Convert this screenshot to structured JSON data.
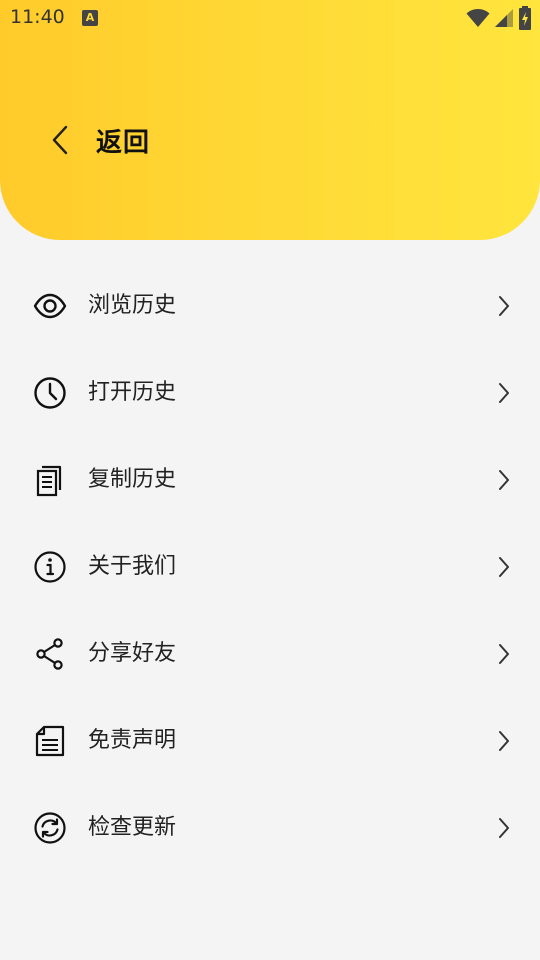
{
  "status_bar": {
    "time": "11:40",
    "notification_letter": "A"
  },
  "header": {
    "back_label": "返回",
    "gradient_start": "#ffcb2b",
    "gradient_end": "#ffe53d"
  },
  "menu": {
    "items": [
      {
        "label": "浏览历史",
        "icon": "eye-icon"
      },
      {
        "label": "打开历史",
        "icon": "clock-icon"
      },
      {
        "label": "复制历史",
        "icon": "copy-document-icon"
      },
      {
        "label": "关于我们",
        "icon": "info-icon"
      },
      {
        "label": "分享好友",
        "icon": "share-icon"
      },
      {
        "label": "免责声明",
        "icon": "document-icon"
      },
      {
        "label": "检查更新",
        "icon": "refresh-icon"
      }
    ]
  }
}
